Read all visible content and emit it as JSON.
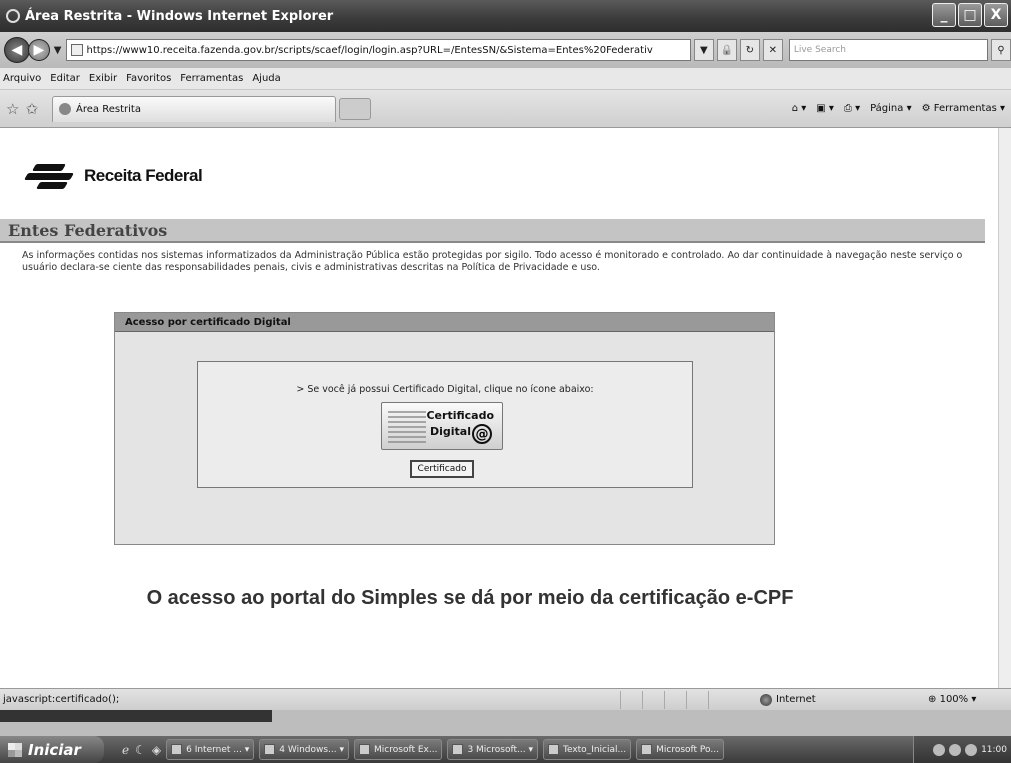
{
  "window": {
    "title": "Área Restrita - Windows Internet Explorer",
    "min": "_",
    "max": "□",
    "close": "X"
  },
  "address_bar": {
    "url": "https://www10.receita.fazenda.gov.br/scripts/scaef/login/login.asp?URL=/EntesSN/&Sistema=Entes%20Federativ",
    "search_placeholder": "Live Search",
    "refresh": "↻",
    "stop": "✕"
  },
  "menu": [
    "Arquivo",
    "Editar",
    "Exibir",
    "Favoritos",
    "Ferramentas",
    "Ajuda"
  ],
  "tab": {
    "label": "Área Restrita"
  },
  "command_bar": {
    "page": "Página",
    "tools": "Ferramentas"
  },
  "page": {
    "brand": "Receita Federal",
    "section_title": "Entes Federativos",
    "notice": "As informações contidas nos sistemas informatizados da Administração Pública estão protegidas por sigilo. Todo acesso é monitorado e controlado. Ao dar continuidade à navegação neste serviço o usuário declara-se ciente das responsabilidades penais, civis e administrativas descritas na Política de Privacidade e uso.",
    "panel_title": "Acesso por certificado Digital",
    "instruction": "> Se você já possui Certificado Digital, clique no ícone abaixo:",
    "cert_icon_line1": "Certificado",
    "cert_icon_line2": "Digital",
    "cert_icon_symbol": "@",
    "cert_button": "Certificado"
  },
  "caption": "O acesso ao portal do Simples se dá por meio da certificação e-CPF",
  "status": {
    "text": "javascript:certificado();",
    "zone": "Internet",
    "zoom": "100%"
  },
  "taskbar": {
    "start": "Iniciar",
    "tasks": [
      "6 Internet ...",
      "4 Windows...",
      "Microsoft Ex...",
      "3 Microsoft...",
      "Texto_Inicial...",
      "Microsoft Po..."
    ],
    "clock": "11:00"
  }
}
